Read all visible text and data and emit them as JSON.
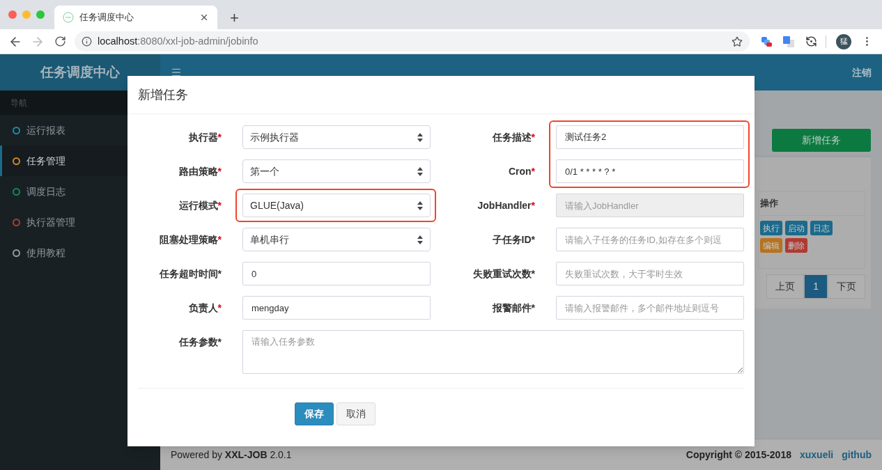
{
  "browser": {
    "tab": {
      "title": "任务调度中心",
      "selected": true
    },
    "new_tab": "+",
    "url_host": "localhost",
    "url_rest": ":8080/xxl-job-admin/jobinfo",
    "avatar": "猛"
  },
  "app": {
    "brand": "任务调度中心",
    "logout": "注销"
  },
  "sidebar": {
    "section": "导航",
    "items": [
      {
        "label": "运行报表",
        "color": "#1e8aa6",
        "selected": false
      },
      {
        "label": "任务管理",
        "color": "#c98a2c",
        "selected": true
      },
      {
        "label": "调度日志",
        "color": "#0e8a52",
        "selected": false
      },
      {
        "label": "执行器管理",
        "color": "#b23a30",
        "selected": false
      },
      {
        "label": "使用教程",
        "color": "#9a9a9a",
        "selected": false
      }
    ]
  },
  "page": {
    "add_button": "新增任务",
    "table": {
      "columns": [
        "操作"
      ],
      "actions": [
        {
          "label": "执行",
          "color": "#1c6a8c"
        },
        {
          "label": "启动",
          "color": "#1c6a8c"
        },
        {
          "label": "日志",
          "color": "#1c6a8c"
        },
        {
          "label": "编辑",
          "color": "#b6731f"
        },
        {
          "label": "删除",
          "color": "#af3a32"
        }
      ]
    },
    "pagination": [
      {
        "label": "上页",
        "selected": false
      },
      {
        "label": "1",
        "selected": true
      },
      {
        "label": "下页",
        "selected": false
      }
    ]
  },
  "footer": {
    "powered": "Powered by **XXL-JOB** 2.0.1",
    "copyright": "Copyright © 2015-2018",
    "links": [
      "xuxueli",
      "github"
    ]
  },
  "dialog": {
    "title": "新增任务",
    "left": [
      {
        "highlighted": false,
        "fields": [
          {
            "label": "执行器",
            "star": "*",
            "star_red": true,
            "kind": "select",
            "value": "示例执行器",
            "disabled": false
          },
          {
            "label": "路由策略",
            "star": "*",
            "star_red": true,
            "kind": "select",
            "value": "第一个",
            "disabled": false
          }
        ]
      },
      {
        "highlighted": true,
        "fields": [
          {
            "label": "运行模式",
            "star": "*",
            "star_red": true,
            "kind": "select",
            "value": "GLUE(Java)",
            "disabled": false
          }
        ]
      },
      {
        "highlighted": false,
        "fields": [
          {
            "label": "阻塞处理策略",
            "star": "*",
            "star_red": true,
            "kind": "select",
            "value": "单机串行",
            "disabled": false
          },
          {
            "label": "任务超时时间",
            "star": "*",
            "star_red": false,
            "kind": "input",
            "value": "0",
            "disabled": false
          },
          {
            "label": "负责人",
            "star": "*",
            "star_red": true,
            "kind": "input",
            "value": "mengday",
            "disabled": false
          }
        ]
      }
    ],
    "right": [
      {
        "highlighted": true,
        "fields": [
          {
            "label": "任务描述",
            "star": "*",
            "star_red": true,
            "kind": "input",
            "value": "测试任务2",
            "disabled": false
          },
          {
            "label": "Cron",
            "star": "*",
            "star_red": true,
            "kind": "input",
            "value": "0/1 * * * * ? *",
            "disabled": false
          }
        ]
      },
      {
        "highlighted": false,
        "fields": [
          {
            "label": "JobHandler",
            "star": "*",
            "star_red": true,
            "kind": "input",
            "placeholder": "请输入JobHandler",
            "disabled": true
          },
          {
            "label": "子任务ID",
            "star": "*",
            "star_red": false,
            "kind": "input",
            "placeholder": "请输入子任务的任务ID,如存在多个则逗",
            "disabled": false
          },
          {
            "label": "失败重试次数",
            "star": "*",
            "star_red": false,
            "kind": "input",
            "placeholder": "失败重试次数，大于零时生效",
            "disabled": false
          },
          {
            "label": "报警邮件",
            "star": "*",
            "star_red": false,
            "kind": "input",
            "placeholder": "请输入报警邮件，多个邮件地址则逗号",
            "disabled": false
          }
        ]
      }
    ],
    "params": {
      "label": "任务参数",
      "star": "*",
      "star_red": false,
      "kind": "textarea",
      "placeholder": "请输入任务参数",
      "disabled": false
    },
    "buttons": [
      {
        "label": "保存",
        "kind": "primary"
      },
      {
        "label": "取消",
        "kind": "default"
      }
    ]
  }
}
